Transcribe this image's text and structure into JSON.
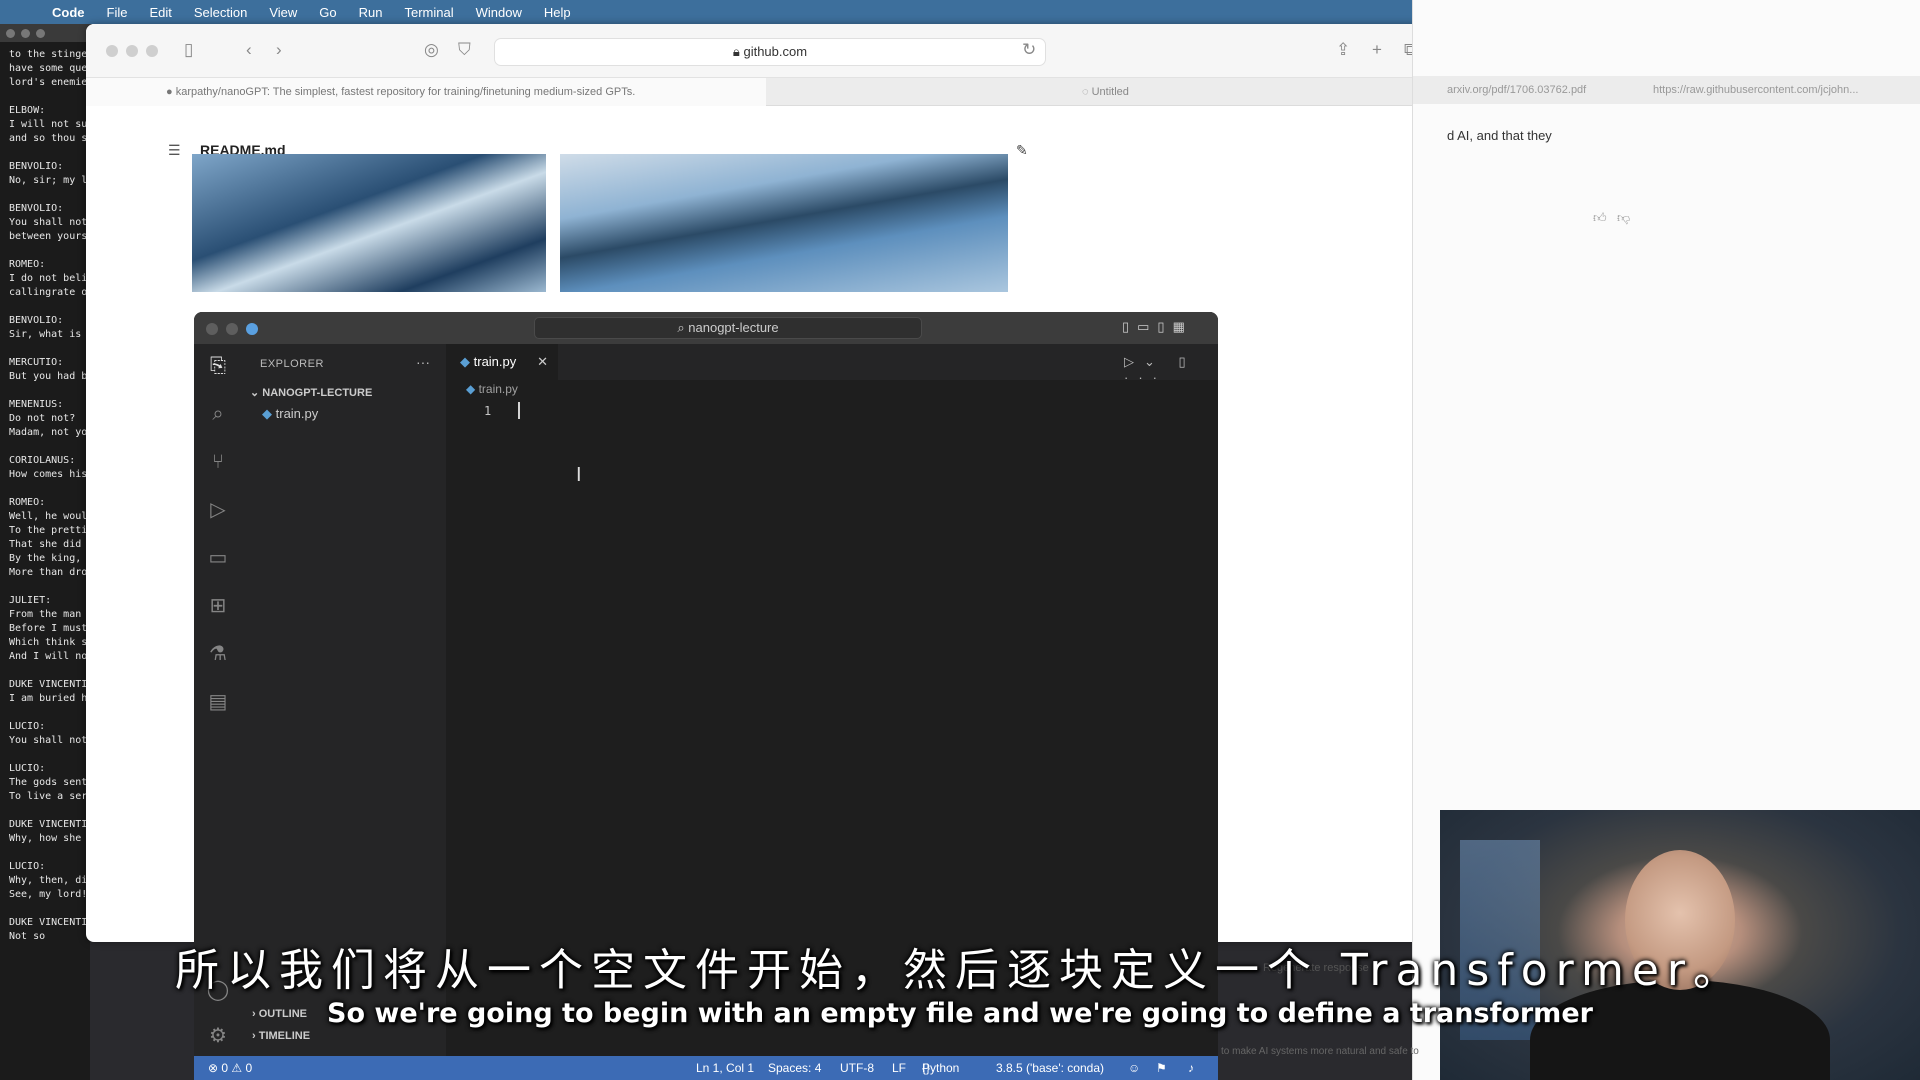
{
  "menubar": {
    "app": "Code",
    "items": [
      "File",
      "Edit",
      "Selection",
      "View",
      "Go",
      "Run",
      "Terminal",
      "Window",
      "Help"
    ]
  },
  "terminal": {
    "text": "to the stinge\nhave some que\nlord's enemie\n\nELBOW:\nI will not su\nand so thou s\n\nBENVOLIO:\nNo, sir; my l\n\nBENVOLIO:\nYou shall not\nbetween yours\n\nROMEO:\nI do not beli\ncallingrate o\n\nBENVOLIO:\nSir, what is\n\nMERCUTIO:\nBut you had b\n\nMENENIUS:\nDo not not?\nMadam, not yo\n\nCORIOLANUS:\nHow comes his\n\nROMEO:\nWell, he woul\nTo the pretti\nThat she did\nBy the king,\nMore than dro\n\nJULIET:\nFrom the man\nBefore I must\nWhich think s\nAnd I will no\n\nDUKE VINCENTI\nI am buried h\n\nLUCIO:\nYou shall not\n\nLUCIO:\nThe gods sent\nTo live a ser\n\nDUKE VINCENTI\nWhy, how she\n\nLUCIO:\nWhy, then, di\nSee, my lord!\n\nDUKE VINCENTIO:\nNot so"
  },
  "safari": {
    "url": "github.com",
    "tabs": [
      "karpathy/nanoGPT: The simplest, fastest repository for training/finetuning medium-sized GPTs.",
      "Untitled",
      "arxiv.org/pdf/1706.03762.pdf",
      "https://raw.githubusercontent.com/jcjohn..."
    ],
    "readme_title": "README.md"
  },
  "right_browser": {
    "text": "d AI, and that they",
    "regenerate": "Regenerate response",
    "footer": "to make AI systems more natural and safe to"
  },
  "vscode": {
    "title": "nanogpt-lecture",
    "explorer_label": "EXPLORER",
    "project": "NANOGPT-LECTURE",
    "file": "train.py",
    "tab": "train.py",
    "breadcrumb": "train.py",
    "line_number": "1",
    "outline": "OUTLINE",
    "timeline": "TIMELINE",
    "status": {
      "problems": "⊗ 0 ⚠ 0",
      "position": "Ln 1, Col 1",
      "spaces": "Spaces: 4",
      "encoding": "UTF-8",
      "eol": "LF",
      "language": "Python",
      "interpreter": "3.8.5 ('base': conda)"
    }
  },
  "subtitles": {
    "zh": "所以我们将从一个空文件开始，然后逐块定义一个 Transformer。",
    "en": "So we're going to begin with an empty file and we're going to define a transformer"
  },
  "colors": {
    "menubar": "#3d6f9c",
    "vscode_status": "#3c6bb5",
    "editor_bg": "#1e1e1e"
  }
}
